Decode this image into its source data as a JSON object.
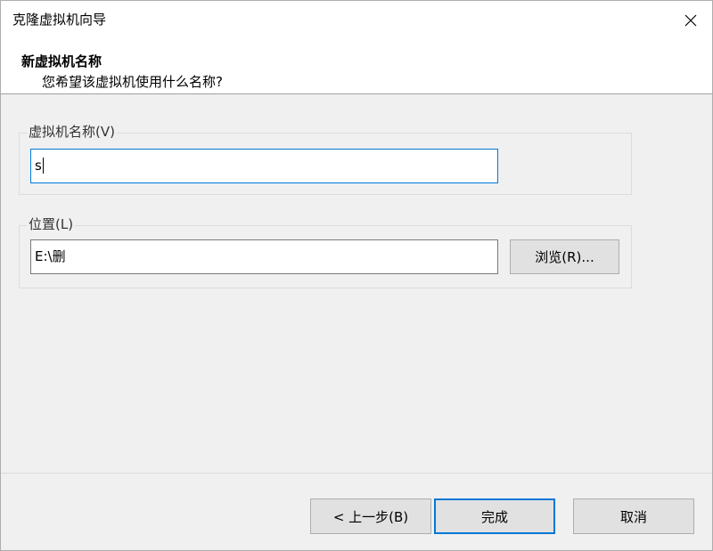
{
  "window": {
    "title": "克隆虚拟机向导",
    "close_icon": "close-icon"
  },
  "header": {
    "title": "新虚拟机名称",
    "subtitle": "您希望该虚拟机使用什么名称?"
  },
  "name_group": {
    "label": "虚拟机名称(V)",
    "value": "s"
  },
  "location_group": {
    "label": "位置(L)",
    "value": "E:\\删",
    "browse_label": "浏览(R)..."
  },
  "footer": {
    "back_label": "< 上一步(B)",
    "finish_label": "完成",
    "cancel_label": "取消"
  },
  "colors": {
    "accent": "#0078d7",
    "button_bg": "#e1e1e1",
    "dialog_bg": "#f0f0f0"
  }
}
